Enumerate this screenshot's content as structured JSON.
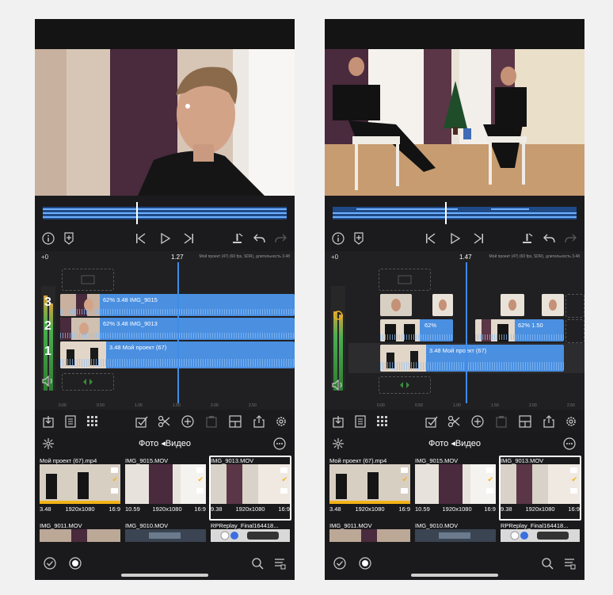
{
  "screens": [
    {
      "timeline": {
        "plus": "+0",
        "time": "1.27",
        "info": "Мой проект (47) (60 fps, SDR), длительность 3.48",
        "tracks": [
          {
            "number": "3",
            "label": "62%   3.48   IMG_9015"
          },
          {
            "number": "2",
            "label": "62%   3.48   IMG_9013"
          },
          {
            "number": "1",
            "label": "3.48   Мой проект (67)"
          }
        ],
        "ruler": [
          "0.00",
          "0.50",
          "1.00",
          "1.50",
          "2.00",
          "2.50"
        ]
      },
      "browser": {
        "title": "Фото ◂Видео",
        "items": [
          {
            "name": "Мой проект (67).mp4",
            "duration": "3.48",
            "resolution": "1920x1080",
            "aspect": "16:9"
          },
          {
            "name": "IMG_9015.MOV",
            "duration": "10.59",
            "resolution": "1920x1080",
            "aspect": "16:9"
          },
          {
            "name": "IMG_9013.MOV",
            "duration": "9.38",
            "resolution": "1920x1080",
            "aspect": "16:9"
          }
        ],
        "row2": [
          "IMG_9011.MOV",
          "IMG_9010.MOV",
          "RPReplay_Final164418..."
        ]
      }
    },
    {
      "timeline": {
        "plus": "+0",
        "time": "1.47",
        "info": "Мой проект (47) (60 fps, SDR), длительность 3.48",
        "tracks": [
          {
            "number": "",
            "label": ""
          },
          {
            "number": "",
            "label": "62%",
            "label2": "62%   1.50"
          },
          {
            "number": "",
            "label": "3.48   Мой проект (67)"
          }
        ],
        "ruler": [
          "0.00",
          "0.50",
          "1.00",
          "1.50",
          "2.00",
          "2.50"
        ]
      },
      "browser": {
        "title": "Фото ◂Видео",
        "items": [
          {
            "name": "Мой проект (67).mp4",
            "duration": "3.48",
            "resolution": "1920x1080",
            "aspect": "16:9"
          },
          {
            "name": "IMG_9015.MOV",
            "duration": "10.59",
            "resolution": "1920x1080",
            "aspect": "16:9"
          },
          {
            "name": "IMG_9013.MOV",
            "duration": "9.38",
            "resolution": "1920x1080",
            "aspect": "16:9"
          }
        ],
        "row2": [
          "IMG_9011.MOV",
          "IMG_9010.MOV",
          "RPReplay_Final164418..."
        ]
      }
    }
  ],
  "colors": {
    "clip": "#4a8fe0",
    "accent": "#f2b317",
    "background": "#1b1b1d"
  }
}
